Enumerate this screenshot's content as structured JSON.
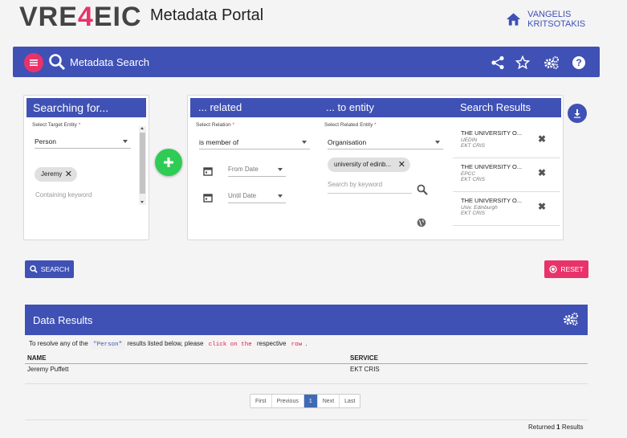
{
  "logo": {
    "part1": "VRE",
    "part2": "4",
    "part3": "EIC"
  },
  "portal_title": "Metadata Portal",
  "user_name": "VANGELIS KRITSOTAKIS",
  "topbar": {
    "title": "Metadata Search"
  },
  "searching": {
    "header": "Searching for...",
    "target_label": "Select Target Entity",
    "target_value": "Person",
    "chip": "Jeremy",
    "keyword_placeholder": "Containing keyword"
  },
  "related": {
    "header": "... related",
    "relation_label": "Select Relation",
    "relation_value": "is member of",
    "from_date": "From Date",
    "until_date": "Until Date"
  },
  "entity": {
    "header": "... to entity",
    "entity_label": "Select Related Entity",
    "entity_value": "Organisation",
    "chip": "university of edinb...",
    "keyword_placeholder": "Search by keyword"
  },
  "results": {
    "header": "Search Results",
    "items": [
      {
        "title": "THE UNIVERSITY O...",
        "sub1": "UEDIN",
        "sub2": "EKT CRIS"
      },
      {
        "title": "THE UNIVERSITY O...",
        "sub1": "EPCC",
        "sub2": "EKT CRIS"
      },
      {
        "title": "THE UNIVERSITY O...",
        "sub1": "Univ. Edinburgh",
        "sub2": "EKT CRIS"
      }
    ]
  },
  "buttons": {
    "search": "SEARCH",
    "reset": "RESET"
  },
  "data_results": {
    "title": "Data Results",
    "instr_1": "To resolve any of the",
    "instr_code1": "\"Person\"",
    "instr_2": "results listed below, please",
    "instr_code2": "click on the",
    "instr_3": "respective",
    "instr_code3": "row",
    "instr_4": ".",
    "col_name": "NAME",
    "col_service": "SERVICE",
    "rows": [
      {
        "name": "Jeremy Puffett",
        "service": "EKT CRIS"
      }
    ]
  },
  "pager": {
    "first": "First",
    "previous": "Previous",
    "page": "1",
    "next": "Next",
    "last": "Last"
  },
  "footer": {
    "returned": "Returned",
    "count": "1",
    "results": "Results"
  },
  "colors": {
    "primary": "#3f51b5",
    "accent": "#e8336a",
    "add": "#2ecc55"
  }
}
